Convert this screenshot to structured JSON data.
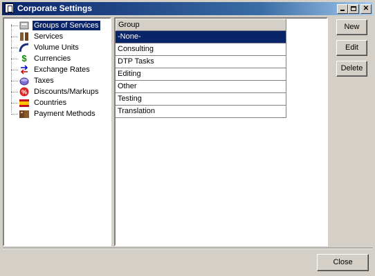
{
  "window": {
    "title": "Corporate Settings"
  },
  "titlebar_buttons": {
    "minimize": "minimize",
    "maximize": "maximize",
    "close": "✕"
  },
  "tree": {
    "items": [
      {
        "label": "Groups of Services",
        "icon": "groups-icon",
        "selected": true
      },
      {
        "label": "Services",
        "icon": "services-icon",
        "selected": false
      },
      {
        "label": "Volume Units",
        "icon": "volume-icon",
        "selected": false
      },
      {
        "label": "Currencies",
        "icon": "currency-icon",
        "selected": false
      },
      {
        "label": "Exchange Rates",
        "icon": "exchange-icon",
        "selected": false
      },
      {
        "label": "Taxes",
        "icon": "taxes-icon",
        "selected": false
      },
      {
        "label": "Discounts/Markups",
        "icon": "discount-icon",
        "selected": false
      },
      {
        "label": "Countries",
        "icon": "flag-icon",
        "selected": false
      },
      {
        "label": "Payment Methods",
        "icon": "payment-icon",
        "selected": false
      }
    ]
  },
  "grid": {
    "header": "Group",
    "rows": [
      "-None-",
      "Consulting",
      "DTP Tasks",
      "Editing",
      "Other",
      "Testing",
      "Translation"
    ],
    "selected_row": "-None-"
  },
  "buttons": {
    "new_label": "New",
    "edit_label": "Edit",
    "delete_label": "Delete",
    "close_label": "Close"
  },
  "colors": {
    "selection": "#0a246a",
    "face": "#d4d0c8"
  }
}
